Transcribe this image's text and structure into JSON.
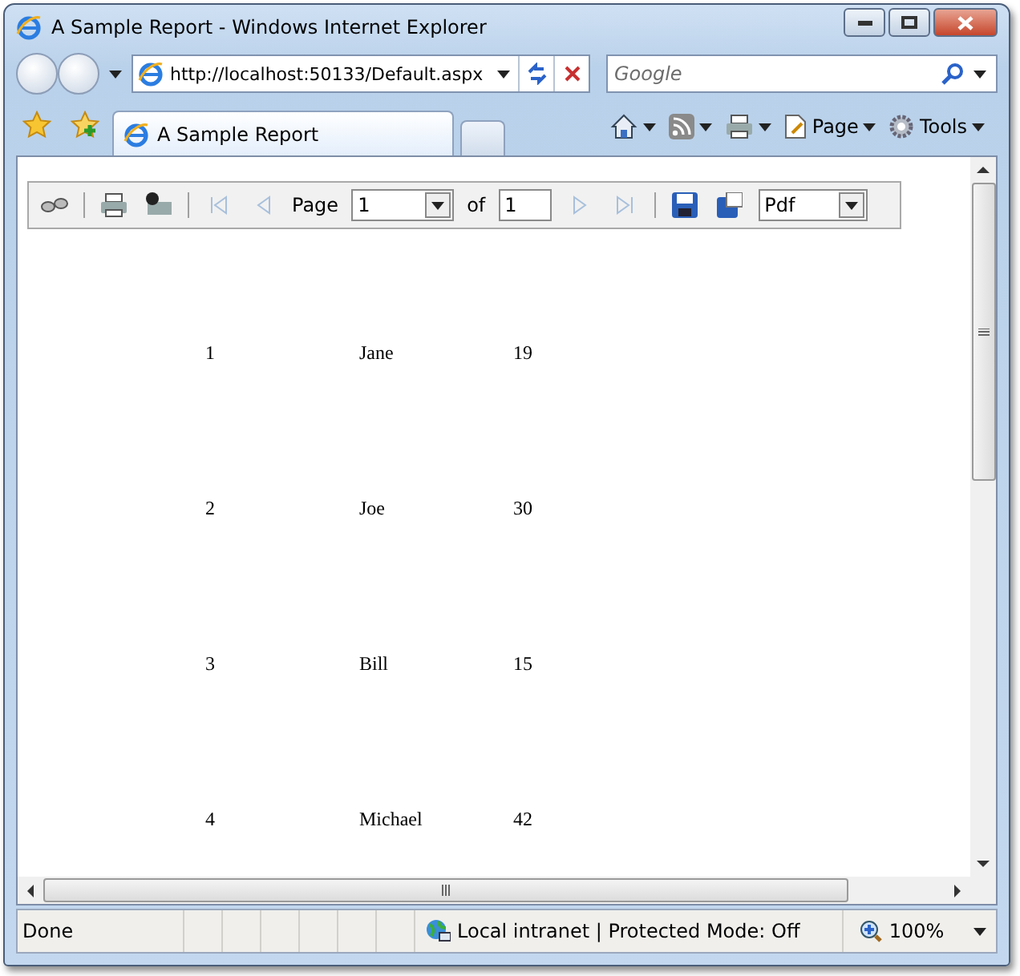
{
  "window": {
    "title": "A Sample Report - Windows Internet Explorer"
  },
  "address_bar": {
    "value": "http://localhost:50133/Default.aspx"
  },
  "search": {
    "placeholder": "Google"
  },
  "tabs": [
    {
      "label": "A Sample Report",
      "selected": true
    }
  ],
  "command_bar": [
    {
      "kind": "home"
    },
    {
      "kind": "feeds"
    },
    {
      "kind": "print"
    },
    {
      "kind": "page",
      "label": "Page"
    },
    {
      "kind": "tools",
      "label": "Tools"
    }
  ],
  "report_toolbar": {
    "page_label": "Page",
    "page_value": "1",
    "of_label": "of",
    "page_count": "1",
    "format": "Pdf"
  },
  "rows": [
    {
      "cells": [
        "1",
        "Jane",
        "19"
      ]
    },
    {
      "cells": [
        "2",
        "Joe",
        "30"
      ]
    },
    {
      "cells": [
        "3",
        "Bill",
        "15"
      ]
    },
    {
      "cells": [
        "4",
        "Michael",
        "42"
      ]
    }
  ],
  "status_bar": {
    "status": "Done",
    "zone": "Local intranet | Protected Mode: Off",
    "zoom": "100%"
  }
}
